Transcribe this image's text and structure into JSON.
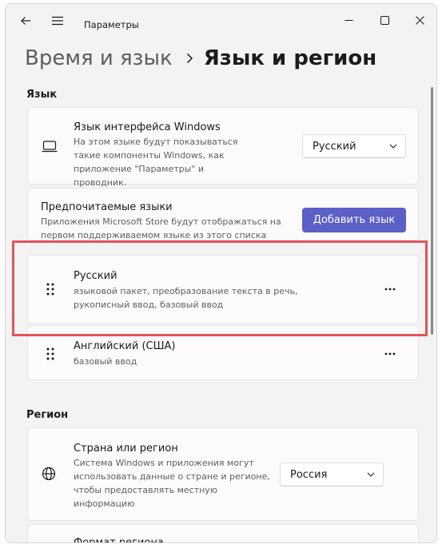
{
  "window": {
    "app_title": "Параметры",
    "icons": {
      "back": "back-arrow-icon",
      "menu": "hamburger-menu-icon",
      "minimize": "minimize-icon",
      "maximize": "maximize-icon",
      "close": "close-icon"
    }
  },
  "breadcrumb": {
    "parent": "Время и язык",
    "current": "Язык и регион"
  },
  "language_section": {
    "label": "Язык",
    "interface_language": {
      "icon": "monitor-icon",
      "title": "Язык интерфейса Windows",
      "description": "На этом языке будут показываться такие компоненты Windows, как приложение \"Параметры\" и проводник.",
      "selected": "Русский"
    },
    "preferred": {
      "title": "Предпочитаемые языки",
      "description": "Приложения Microsoft Store будут отображаться на первом поддерживаемом языке из этого списка",
      "add_button": "Добавить язык"
    },
    "languages": [
      {
        "name": "Русский",
        "features": "языковой пакет, преобразование текста в речь, рукописный ввод, базовый ввод"
      },
      {
        "name": "Английский (США)",
        "features": "базовый ввод"
      }
    ]
  },
  "region_section": {
    "label": "Регион",
    "country": {
      "icon": "globe-icon",
      "title": "Страна или регион",
      "description": "Система Windows и приложения могут использовать данные о стране и регионе, чтобы предоставлять местную информацию",
      "selected": "Россия"
    },
    "format": {
      "title": "Формат региона"
    }
  },
  "colors": {
    "accent": "#5b5fc7",
    "highlight": "#e0555a"
  }
}
